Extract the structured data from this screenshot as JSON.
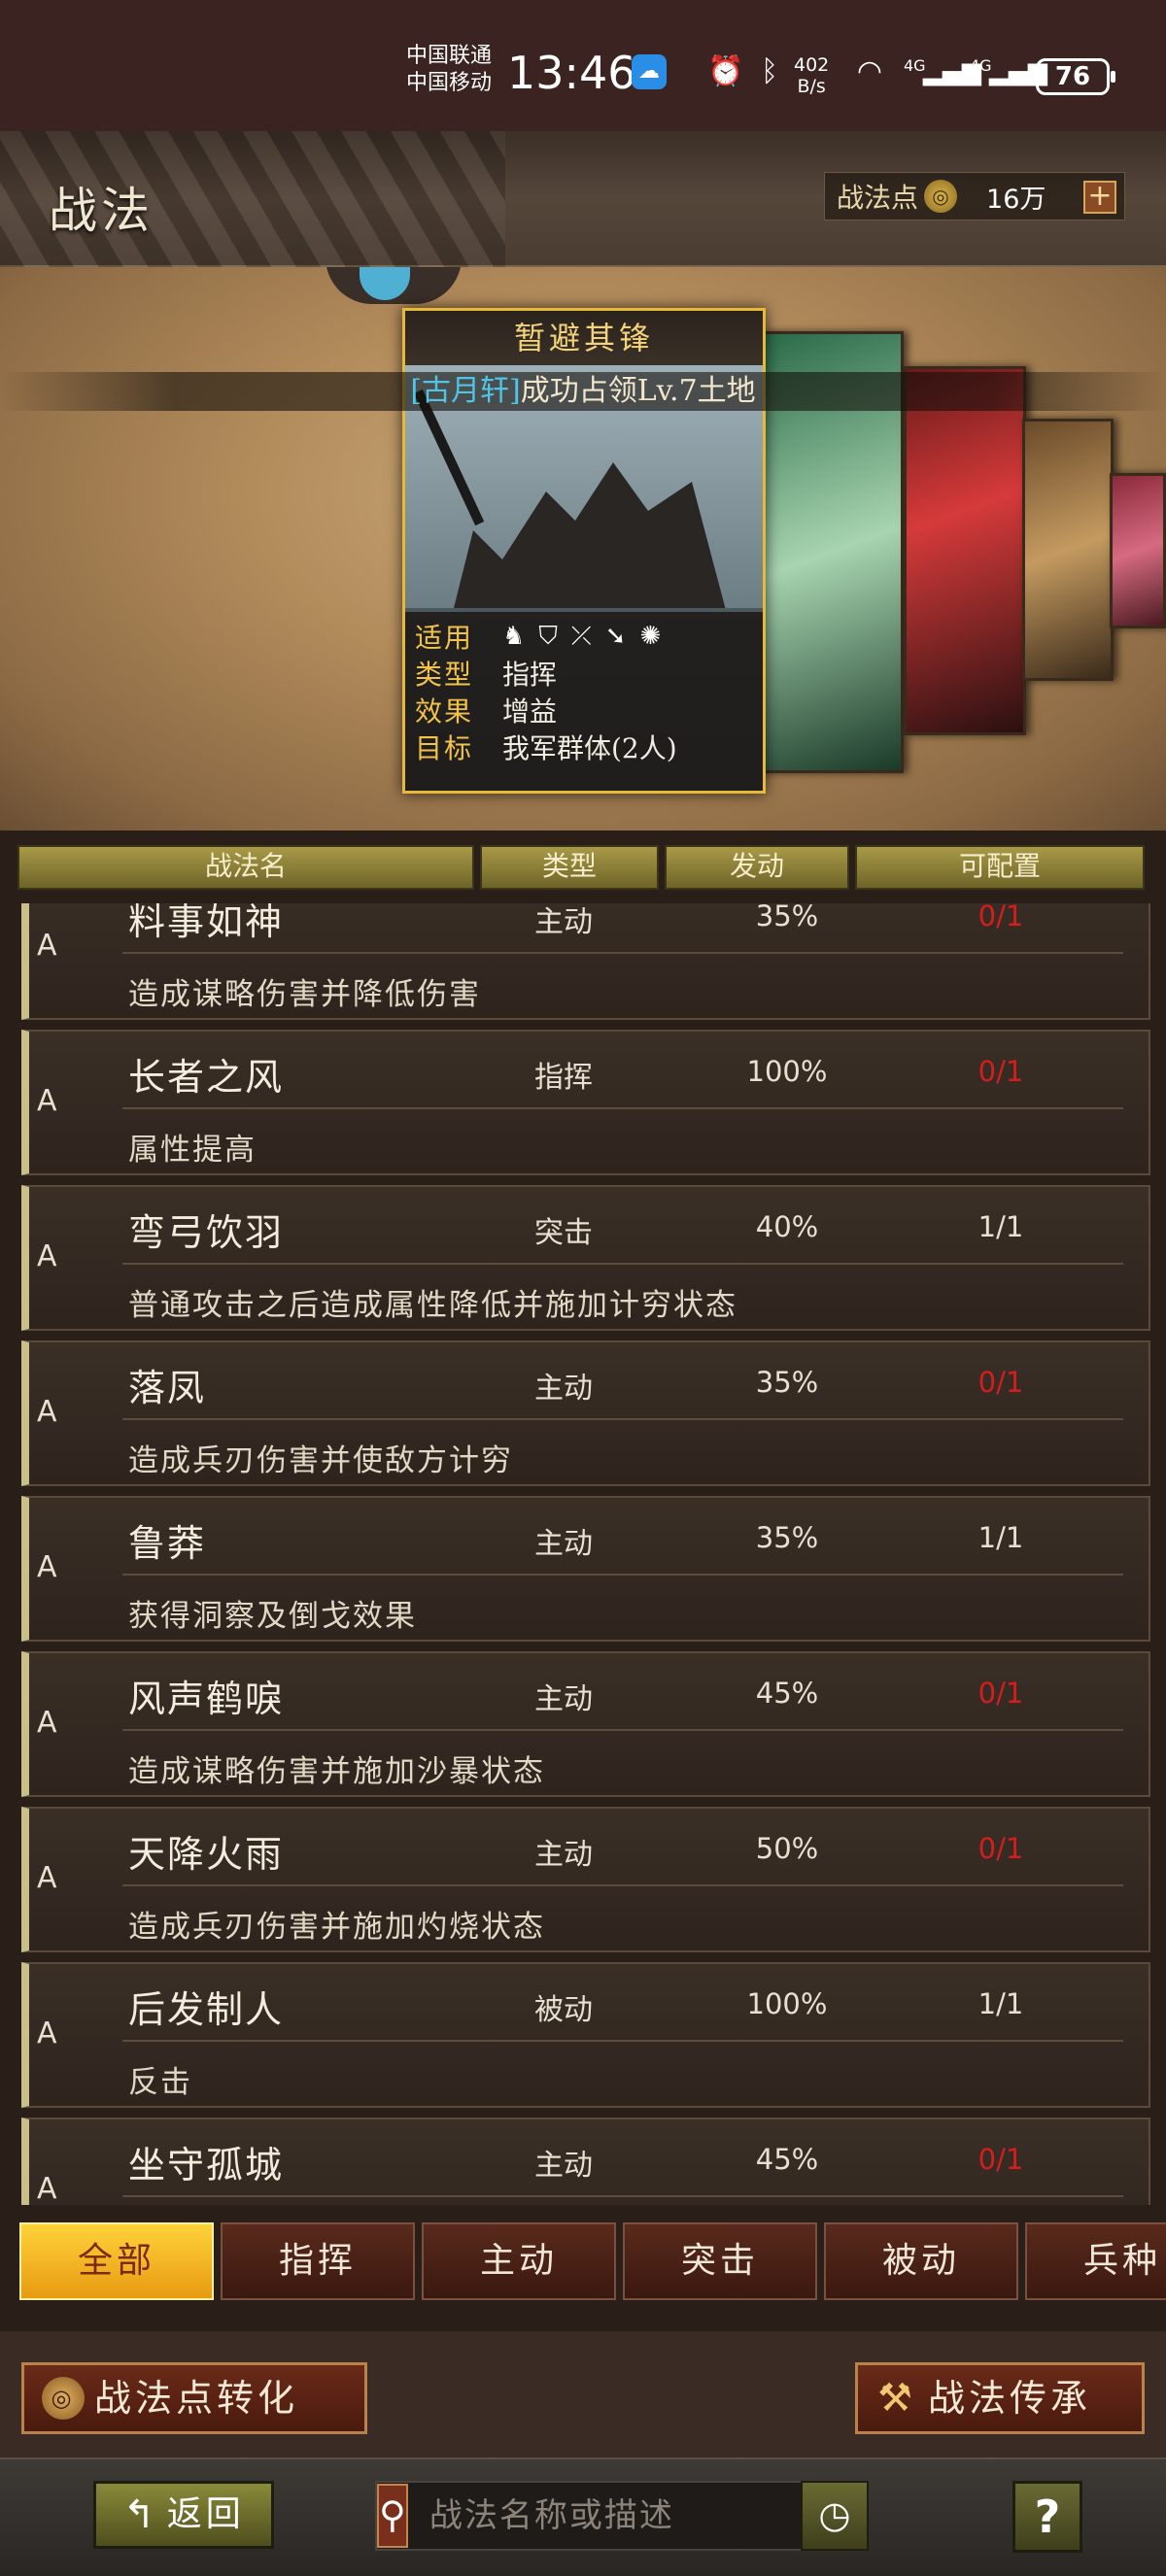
{
  "status_bar": {
    "carrier_1": "中国联通",
    "carrier_2": "中国移动",
    "time": "13:46",
    "net_speed_value": "402",
    "net_speed_unit": "B/s",
    "signal_label_1": "4G",
    "signal_label_2": "4G",
    "battery": "76",
    "icons": [
      "weather-icon",
      "alarm-icon",
      "bluetooth-icon",
      "wifi-icon",
      "signal-icon",
      "battery-icon"
    ]
  },
  "header": {
    "title": "战法",
    "points_label": "战法点",
    "points_value": "16万",
    "add_label": "+"
  },
  "notice": {
    "player": "[古月轩]",
    "message": "成功占领Lv.7土地"
  },
  "featured_card": {
    "name": "暂避其锋",
    "applies_label": "适用",
    "type_label": "类型",
    "type_value": "指挥",
    "effect_label": "效果",
    "effect_value": "增益",
    "target_label": "目标",
    "target_value": "我军群体(2人)",
    "unit_icons": [
      "cavalry-icon",
      "shield-icon",
      "archer-icon",
      "spear-icon",
      "siege-icon"
    ]
  },
  "columns": {
    "name": "战法名",
    "type": "类型",
    "rate": "发动",
    "slots": "可配置"
  },
  "tactics": [
    {
      "grade": "A",
      "name": "料事如神",
      "type": "主动",
      "rate": "35%",
      "slots": "0/1",
      "desc": "造成谋略伤害并降低伤害",
      "slots_red": true
    },
    {
      "grade": "A",
      "name": "长者之风",
      "type": "指挥",
      "rate": "100%",
      "slots": "0/1",
      "desc": "属性提高",
      "slots_red": true
    },
    {
      "grade": "A",
      "name": "弯弓饮羽",
      "type": "突击",
      "rate": "40%",
      "slots": "1/1",
      "desc": "普通攻击之后造成属性降低并施加计穷状态",
      "slots_red": false
    },
    {
      "grade": "A",
      "name": "落凤",
      "type": "主动",
      "rate": "35%",
      "slots": "0/1",
      "desc": "造成兵刃伤害并使敌方计穷",
      "slots_red": true
    },
    {
      "grade": "A",
      "name": "鲁莽",
      "type": "主动",
      "rate": "35%",
      "slots": "1/1",
      "desc": "获得洞察及倒戈效果",
      "slots_red": false
    },
    {
      "grade": "A",
      "name": "风声鹤唳",
      "type": "主动",
      "rate": "45%",
      "slots": "0/1",
      "desc": "造成谋略伤害并施加沙暴状态",
      "slots_red": true
    },
    {
      "grade": "A",
      "name": "天降火雨",
      "type": "主动",
      "rate": "50%",
      "slots": "0/1",
      "desc": "造成兵刃伤害并施加灼烧状态",
      "slots_red": true
    },
    {
      "grade": "A",
      "name": "后发制人",
      "type": "被动",
      "rate": "100%",
      "slots": "1/1",
      "desc": "反击",
      "slots_red": false
    },
    {
      "grade": "A",
      "name": "坐守孤城",
      "type": "主动",
      "rate": "45%",
      "slots": "0/1",
      "desc": "",
      "slots_red": true
    }
  ],
  "tabs": [
    "全部",
    "指挥",
    "主动",
    "突击",
    "被动",
    "兵种"
  ],
  "active_tab": "全部",
  "actions": {
    "convert_label": "战法点转化",
    "inherit_label": "战法传承"
  },
  "bottom": {
    "back_label": "返回",
    "search_placeholder": "战法名称或描述",
    "help_label": "?"
  },
  "colors": {
    "accent_gold": "#e6b93a",
    "slot_red": "#d41e1e",
    "tab_active": "#f2b020"
  }
}
